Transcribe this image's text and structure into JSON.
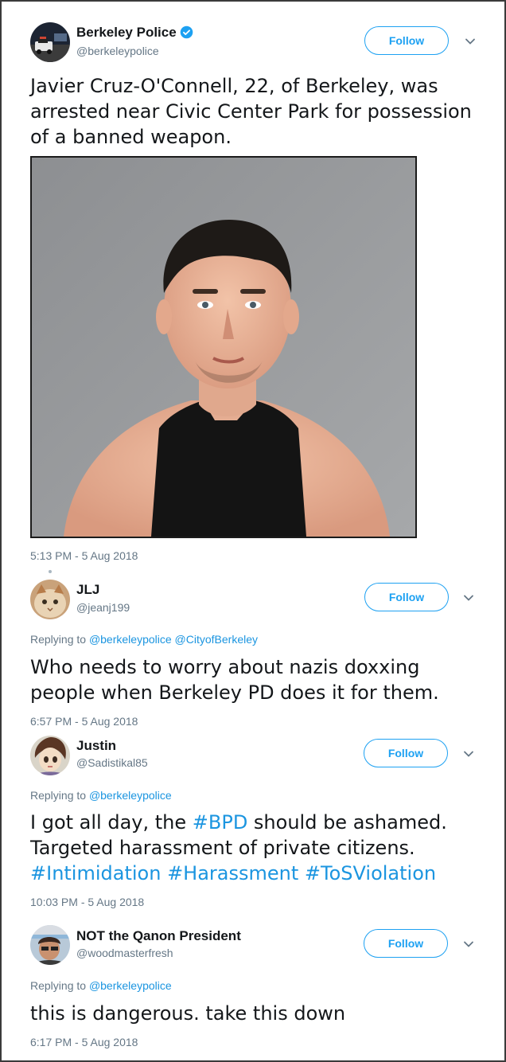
{
  "main_tweet": {
    "name": "Berkeley Police",
    "handle": "@berkeleypolice",
    "follow_label": "Follow",
    "text": "Javier Cruz-O'Connell, 22, of Berkeley, was arrested near Civic Center Park for possession of a banned weapon.",
    "text_lines": [
      "Javier Cruz-O'Connell, 22, of Berkeley, was",
      "arrested near Civic Center Park for possession",
      "of a banned weapon."
    ],
    "timestamp": "5:13 PM - 5 Aug 2018"
  },
  "replies": [
    {
      "name": "JLJ",
      "handle": "@jeanj199",
      "follow_label": "Follow",
      "replying_prefix": "Replying to",
      "replying_to": "@berkeleypolice @CityofBerkeley",
      "text_lines": [
        "Who needs to worry about nazis doxxing",
        "people when Berkeley PD does it for them."
      ],
      "timestamp": "6:57 PM - 5 Aug 2018"
    },
    {
      "name": "Justin",
      "handle": "@Sadistikal85",
      "follow_label": "Follow",
      "replying_prefix": "Replying to",
      "replying_to": "@berkeleypolice",
      "text_line1_a": "I got all day, the ",
      "text_line1_tag": "#BPD",
      "text_line1_b": " should be ashamed.",
      "text_line2": "Targeted harassment of private citizens.",
      "text_line3": "#Intimidation #Harassment #ToSViolation",
      "timestamp": "10:03 PM - 5 Aug 2018"
    },
    {
      "name": "NOT the Qanon President",
      "handle": "@woodmasterfresh",
      "follow_label": "Follow",
      "replying_prefix": "Replying to",
      "replying_to": "@berkeleypolice",
      "text_lines": [
        "this is dangerous. take this down"
      ],
      "timestamp": "6:17 PM - 5 Aug 2018"
    }
  ],
  "colors": {
    "accent": "#1da1f2",
    "link": "#1b95e0",
    "muted": "#657786"
  }
}
